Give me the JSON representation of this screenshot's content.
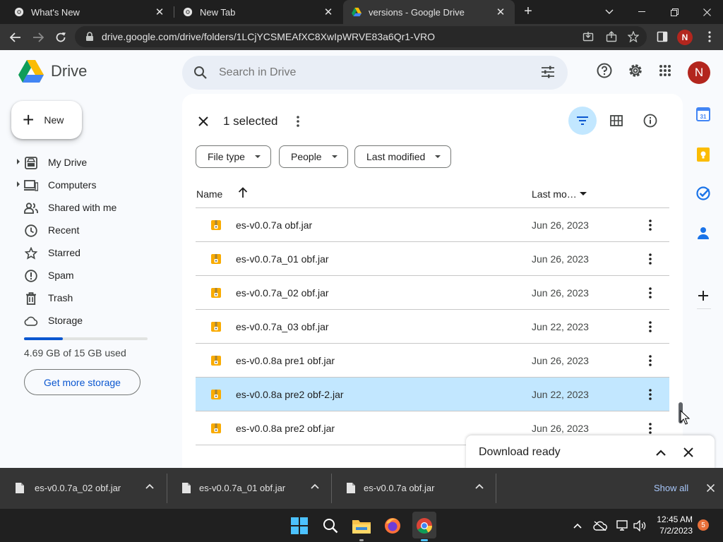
{
  "browser": {
    "tabs": [
      {
        "title": "What's New",
        "icon": "chrome-icon"
      },
      {
        "title": "New Tab",
        "icon": "chrome-icon"
      },
      {
        "title": "versions - Google Drive",
        "icon": "google-drive-icon"
      }
    ],
    "url": "drive.google.com/drive/folders/1LCjYCSMEAfXC8XwIpWRVE83a6Qr1-VRO",
    "profile_initial": "N"
  },
  "drive": {
    "logo_text": "Drive",
    "search_placeholder": "Search in Drive",
    "avatar_initial": "N",
    "new_label": "New",
    "nav": [
      {
        "label": "My Drive",
        "icon": "my-drive-icon",
        "expandable": true
      },
      {
        "label": "Computers",
        "icon": "computers-icon",
        "expandable": true
      },
      {
        "label": "Shared with me",
        "icon": "people-icon",
        "expandable": false
      },
      {
        "label": "Recent",
        "icon": "clock-icon",
        "expandable": false
      },
      {
        "label": "Starred",
        "icon": "star-icon",
        "expandable": false
      },
      {
        "label": "Spam",
        "icon": "spam-icon",
        "expandable": false
      },
      {
        "label": "Trash",
        "icon": "trash-icon",
        "expandable": false
      },
      {
        "label": "Storage",
        "icon": "cloud-icon",
        "expandable": false
      }
    ],
    "storage": {
      "used_text": "4.69 GB of 15 GB used",
      "used_fraction": 0.313,
      "button": "Get more storage"
    },
    "selection_text": "1 selected",
    "filters": [
      "File type",
      "People",
      "Last modified"
    ],
    "columns": {
      "name": "Name",
      "modified": "Last mo…"
    },
    "files": [
      {
        "name": "es-v0.0.7a obf.jar",
        "modified": "Jun 26, 2023",
        "selected": false
      },
      {
        "name": "es-v0.0.7a_01 obf.jar",
        "modified": "Jun 26, 2023",
        "selected": false
      },
      {
        "name": "es-v0.0.7a_02 obf.jar",
        "modified": "Jun 26, 2023",
        "selected": false
      },
      {
        "name": "es-v0.0.7a_03 obf.jar",
        "modified": "Jun 22, 2023",
        "selected": false
      },
      {
        "name": "es-v0.0.8a pre1 obf.jar",
        "modified": "Jun 26, 2023",
        "selected": false
      },
      {
        "name": "es-v0.0.8a pre2 obf-2.jar",
        "modified": "Jun 22, 2023",
        "selected": true
      },
      {
        "name": "es-v0.0.8a pre2 obf.jar",
        "modified": "Jun 26, 2023",
        "selected": false
      }
    ],
    "side_panel": {
      "calendar_day": "31"
    },
    "toast": {
      "title": "Download ready"
    }
  },
  "downloads": {
    "items": [
      "es-v0.0.7a_02 obf.jar",
      "es-v0.0.7a_01 obf.jar",
      "es-v0.0.7a obf.jar"
    ],
    "show_all": "Show all"
  },
  "taskbar": {
    "time": "12:45 AM",
    "date": "7/2/2023",
    "notifications": "5"
  },
  "colors": {
    "accent": "#0b57d0",
    "selected_row": "#c2e7ff",
    "avatar": "#b3261e"
  }
}
